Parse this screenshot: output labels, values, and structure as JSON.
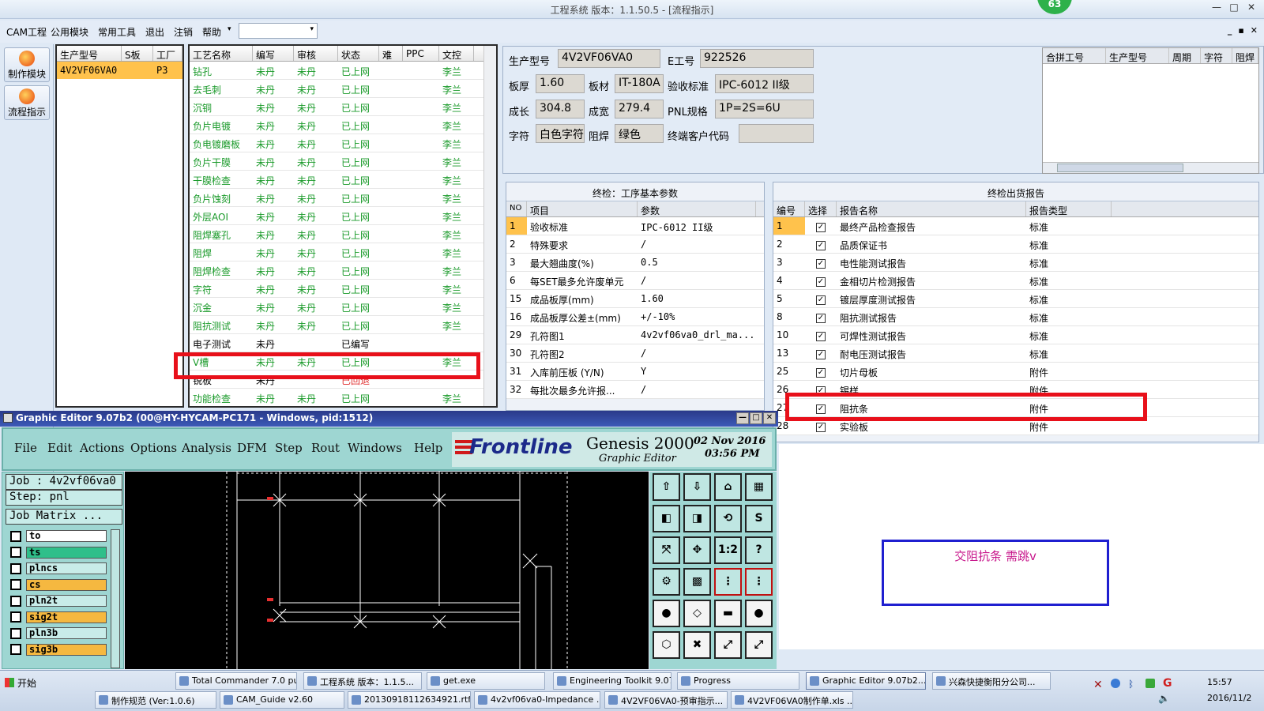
{
  "window": {
    "title": "工程系统   版本：1.1.50.5 - [流程指示]",
    "badge": "63",
    "min": "—",
    "max": "□",
    "close": "✕"
  },
  "menu": {
    "items": [
      "CAM工程",
      "公用模块",
      "常用工具",
      "退出",
      "注销",
      "帮助"
    ],
    "dropdown_arrow": "▾",
    "mdi": [
      "_",
      "▪",
      "✕"
    ]
  },
  "leftnav": {
    "items": [
      "制作模块",
      "流程指示"
    ]
  },
  "grid1": {
    "headers": [
      "生产型号",
      "S板",
      "工厂"
    ],
    "rows": [
      [
        "4V2VF06VA0",
        "",
        "P3"
      ]
    ]
  },
  "grid2": {
    "headers": [
      "工艺名称",
      "编写",
      "审核",
      "状态",
      "难",
      "PPC",
      "文控"
    ],
    "rows": [
      [
        "钻孔",
        "未丹",
        "未丹",
        "已上网",
        "",
        "",
        "李兰"
      ],
      [
        "去毛刺",
        "未丹",
        "未丹",
        "已上网",
        "",
        "",
        "李兰"
      ],
      [
        "沉铜",
        "未丹",
        "未丹",
        "已上网",
        "",
        "",
        "李兰"
      ],
      [
        "负片电镀",
        "未丹",
        "未丹",
        "已上网",
        "",
        "",
        "李兰"
      ],
      [
        "负电镀磨板",
        "未丹",
        "未丹",
        "已上网",
        "",
        "",
        "李兰"
      ],
      [
        "负片干膜",
        "未丹",
        "未丹",
        "已上网",
        "",
        "",
        "李兰"
      ],
      [
        "干膜检查",
        "未丹",
        "未丹",
        "已上网",
        "",
        "",
        "李兰"
      ],
      [
        "负片蚀刻",
        "未丹",
        "未丹",
        "已上网",
        "",
        "",
        "李兰"
      ],
      [
        "外层AOI",
        "未丹",
        "未丹",
        "已上网",
        "",
        "",
        "李兰"
      ],
      [
        "阻焊塞孔",
        "未丹",
        "未丹",
        "已上网",
        "",
        "",
        "李兰"
      ],
      [
        "阻焊",
        "未丹",
        "未丹",
        "已上网",
        "",
        "",
        "李兰"
      ],
      [
        "阻焊检查",
        "未丹",
        "未丹",
        "已上网",
        "",
        "",
        "李兰"
      ],
      [
        "字符",
        "未丹",
        "未丹",
        "已上网",
        "",
        "",
        "李兰"
      ],
      [
        "沉金",
        "未丹",
        "未丹",
        "已上网",
        "",
        "",
        "李兰"
      ],
      [
        "阻抗测试",
        "未丹",
        "未丹",
        "已上网",
        "",
        "",
        "李兰"
      ],
      [
        "电子测试",
        "未丹",
        "",
        "已编写",
        "",
        "",
        ""
      ],
      [
        "V槽",
        "未丹",
        "未丹",
        "已上网",
        "",
        "",
        "李兰"
      ],
      [
        "锐板",
        "未丹",
        "",
        "已回退",
        "",
        "",
        ""
      ],
      [
        "功能检查",
        "未丹",
        "未丹",
        "已上网",
        "",
        "",
        "李兰"
      ]
    ]
  },
  "info": {
    "model_label": "生产型号",
    "model": "4V2VF06VA0",
    "e_label": "E工号",
    "e_no": "922526",
    "thick_label": "板厚",
    "thick": "1.60",
    "mat_label": "板材",
    "mat": "IT-180A",
    "std_label": "验收标准",
    "std": "IPC-6012 II级",
    "len_label": "成长",
    "len": "304.8",
    "wid_label": "成宽",
    "wid": "279.4",
    "pnl_label": "PNL规格",
    "pnl": "1P=2S=6U",
    "char_label": "字符",
    "char": "白色字符",
    "sm_label": "阻焊",
    "sm": "绿色",
    "cust_label": "终端客户代码",
    "cust": ""
  },
  "merge": {
    "headers": [
      "合拼工号",
      "生产型号",
      "周期",
      "字符",
      "阻焊"
    ]
  },
  "params": {
    "title": "终检：工序基本参数",
    "headers": [
      "NO",
      "项目",
      "参数"
    ],
    "rows": [
      [
        "1",
        "验收标准",
        "IPC-6012 II级"
      ],
      [
        "2",
        "特殊要求",
        "/"
      ],
      [
        "3",
        "最大翘曲度(%)",
        "0.5"
      ],
      [
        "6",
        "每SET最多允许废单元",
        "/"
      ],
      [
        "15",
        "成品板厚(mm)",
        "1.60"
      ],
      [
        "16",
        "成品板厚公差±(mm)",
        "+/-10%"
      ],
      [
        "29",
        "孔符图1",
        "4v2vf06va0_drl_ma..."
      ],
      [
        "30",
        "孔符图2",
        "/"
      ],
      [
        "31",
        "入库前压板 (Y/N)",
        "Y"
      ],
      [
        "32",
        "每批次最多允许报...",
        "/"
      ]
    ]
  },
  "reports": {
    "title": "终检出货报告",
    "headers": [
      "编号",
      "选择",
      "报告名称",
      "报告类型"
    ],
    "rows": [
      [
        "1",
        "✓",
        "最终产品检查报告",
        "标准"
      ],
      [
        "2",
        "✓",
        "品质保证书",
        "标准"
      ],
      [
        "3",
        "✓",
        "电性能测试报告",
        "标准"
      ],
      [
        "4",
        "✓",
        "金相切片检测报告",
        "标准"
      ],
      [
        "5",
        "✓",
        "镀层厚度测试报告",
        "标准"
      ],
      [
        "8",
        "✓",
        "阻抗测试报告",
        "标准"
      ],
      [
        "10",
        "✓",
        "可焊性测试报告",
        "标准"
      ],
      [
        "13",
        "✓",
        "耐电压测试报告",
        "标准"
      ],
      [
        "25",
        "✓",
        "切片母板",
        "附件"
      ],
      [
        "26",
        "✓",
        "锡样",
        "附件"
      ],
      [
        "27",
        "✓",
        "阻抗条",
        "附件"
      ],
      [
        "28",
        "✓",
        "实验板",
        "附件"
      ]
    ]
  },
  "note": "交阻抗条   需跳v",
  "ge": {
    "title": "Graphic Editor 9.07b2 (00@HY-HYCAM-PC171 - Windows, pid:1512)",
    "menu": [
      "File",
      "Edit",
      "Actions",
      "Options",
      "Analysis",
      "DFM",
      "Step",
      "Rout",
      "Windows",
      "Help"
    ],
    "brand": "Frontline",
    "product": "Genesis 2000",
    "subtitle": "Graphic Editor",
    "date": "02  Nov  2016",
    "time": "03:56  PM",
    "job": "Job : 4v2vf06va0",
    "step": "Step: pnl",
    "matrix": "Job Matrix ...",
    "layers": [
      {
        "name": "to",
        "color": "#ffffff"
      },
      {
        "name": "ts",
        "color": "#2fbf8a"
      },
      {
        "name": "plncs",
        "color": "#c8ece9"
      },
      {
        "name": "cs",
        "color": "#f5b840"
      },
      {
        "name": "pln2t",
        "color": "#c8ece9"
      },
      {
        "name": "sig2t",
        "color": "#f5b840"
      },
      {
        "name": "pln3b",
        "color": "#c8ece9"
      },
      {
        "name": "sig3b",
        "color": "#f5b840"
      }
    ],
    "tools": [
      "⇧",
      "⇩",
      "⌂",
      "▦",
      "◧",
      "◨",
      "⟲",
      "S",
      "⤧",
      "✥",
      "1:2",
      "?",
      "⚙",
      "▩",
      "⋮",
      "⋮",
      "●",
      "◇",
      "▬",
      "●",
      "⬡",
      "✖",
      "⤢",
      "⤢"
    ]
  },
  "taskbar": {
    "start": "开始",
    "top": [
      "Total Commander 7.0 pu...",
      "工程系统  版本：1.1.5...",
      "get.exe",
      "Engineering Toolkit 9.07...",
      "Progress",
      "Graphic Editor 9.07b2...",
      "兴森快捷衡阳分公司..."
    ],
    "bottom": [
      "制作规范 (Ver:1.0.6)",
      "CAM_Guide v2.60",
      "20130918112634921.rtf...",
      "4v2vf06va0-Impedance ...",
      "4V2VF06VA0-预审指示...",
      "4V2VF06VA0制作单.xls ..."
    ],
    "time": "15:57",
    "date": "2016/11/2"
  }
}
